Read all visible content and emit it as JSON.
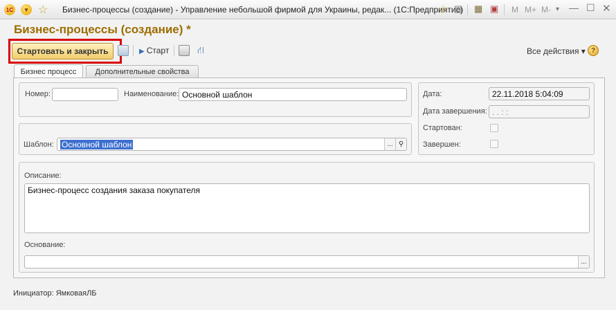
{
  "window": {
    "title": "Бизнес-процессы (создание) - Управление небольшой фирмой для Украины, редак... (1С:Предприятие)",
    "logo_text": "1С",
    "toolbar_m": "M",
    "toolbar_mplus": "M+",
    "toolbar_mminus": "M-"
  },
  "form": {
    "title": "Бизнес-процессы (создание) *",
    "start_close_label": "Стартовать и закрыть",
    "start_label": "Старт",
    "all_actions_label": "Все действия",
    "help_label": "?"
  },
  "tabs": [
    {
      "label": "Бизнес процесс",
      "active": true
    },
    {
      "label": "Дополнительные свойства",
      "active": false
    }
  ],
  "fields": {
    "number": {
      "label": "Номер:",
      "value": ""
    },
    "name": {
      "label": "Наименование:",
      "value": "Основной шаблон"
    },
    "date": {
      "label": "Дата:",
      "value": "22.11.2018  5:04:09"
    },
    "end_date": {
      "label": "Дата завершения:",
      "value": " .  .     :  :"
    },
    "started": {
      "label": "Стартован:",
      "checked": false
    },
    "completed": {
      "label": "Завершен:",
      "checked": false
    },
    "template": {
      "label": "Шаблон:",
      "value": "Основной шаблон"
    },
    "description": {
      "label": "Описание:",
      "value": "Бизнес-процесс создания заказа покупателя"
    },
    "basis": {
      "label": "Основание:",
      "value": ""
    }
  },
  "footer": {
    "initiator": "Инициатор:  ЯмковаяЛБ"
  }
}
